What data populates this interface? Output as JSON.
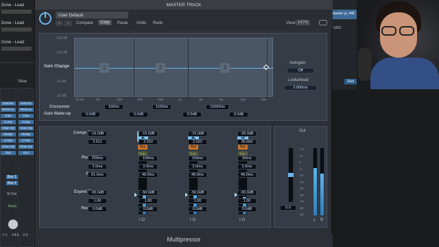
{
  "window": {
    "title": "MASTER TRACK",
    "footer_title": "Multipressor"
  },
  "toolbar": {
    "preset": "User Default",
    "compare": "Compare",
    "copy": "Copy",
    "paste": "Paste",
    "undo": "Undo",
    "redo": "Redo",
    "view_label": "View:",
    "view_value": "147%"
  },
  "graph": {
    "gain_change_label": "Gain Change",
    "y_ticks": [
      "+20 dB",
      "+10 dB",
      "0 dB",
      "-10 dB",
      "-20 dB"
    ],
    "x_ticks": [
      "20 Hz",
      "50",
      "100",
      "200",
      "500",
      "1k",
      "2k",
      "5k",
      "10k",
      "20k"
    ],
    "band_markers": [
      "1",
      "2",
      "3"
    ]
  },
  "crossover": {
    "label": "Crossover",
    "values": [
      "160Hz",
      "1100Hz",
      "15000Hz"
    ],
    "gain_makeup_label": "Gain Make-up",
    "gain_makeup_values": [
      "0.0dB",
      "0.0dB",
      "0.0dB",
      "0.0dB"
    ]
  },
  "autogain": {
    "label": "Autogain",
    "value": "Off",
    "lookahead_label": "Lookahead",
    "lookahead_value": "2.000ms"
  },
  "row_labels": {
    "compr_thresh": "Compr Thresh",
    "ratio": "Ratio",
    "peak_rms": "Peak/RMS",
    "attack": "Attack",
    "release": "Release",
    "expnd_thresh": "Expnd Thresh",
    "ratio2": "Ratio",
    "reduction": "Reduction"
  },
  "bands": [
    {
      "num": "1",
      "compr_thresh": "-16.0dB",
      "ratio": "2.511",
      "peak_rms": "200ms",
      "attack": "2.0ms",
      "release": "61.0ms",
      "expnd_thresh": "-50.0dB",
      "ratio2": "1.00",
      "reduction": "0.0dB",
      "byp": "Byp",
      "solo": "Solo",
      "io": "I  O",
      "level": 0.34
    },
    {
      "num": "2",
      "compr_thresh": "-15.0dB",
      "ratio": "2.022",
      "peak_rms": "100ms",
      "attack": "2.0ms",
      "release": "49.0ms",
      "expnd_thresh": "-50.0dB",
      "ratio2": "1.00",
      "reduction": "0.0dB",
      "byp": "Byp",
      "solo": "Solo",
      "io": "I  O",
      "level": 0.36
    },
    {
      "num": "3",
      "compr_thresh": "-15.0dB",
      "ratio": "2.022",
      "peak_rms": "100ms",
      "attack": "2.0ms",
      "release": "49.0ms",
      "expnd_thresh": "-50.0dB",
      "ratio2": "1.00",
      "reduction": "0.0dB",
      "byp": "Byp",
      "solo": "Solo",
      "io": "I  O",
      "level": 0.32
    },
    {
      "num": "4",
      "compr_thresh": "-39.0dB",
      "ratio": "30.000",
      "peak_rms": "50ms",
      "attack": "2.0ms",
      "release": "49.0ms",
      "expnd_thresh": "-50.0dB",
      "ratio2": "1.00",
      "reduction": "0.0dB",
      "byp": "Byp",
      "solo": "Solo",
      "io": "I  O",
      "level": 0.18
    }
  ],
  "output": {
    "label": "Out",
    "value": "0.0",
    "l": "L",
    "r": "R",
    "scale": [
      "+10",
      "+5",
      "0",
      "-5",
      "-10",
      "-15",
      "-20",
      "-30",
      "-40",
      "-50",
      "-60"
    ],
    "level_l": 0.7,
    "level_r": 0.62
  },
  "daw_left": {
    "tracks": [
      "Done - Lead",
      "Done - Lead",
      "Done - Lead"
    ],
    "strip_buttons": [
      "DeEss2",
      "PitchCor",
      "Gate",
      "Comp",
      "Chan EQ",
      "Multipr",
      "Comp",
      "Chan EQ",
      "Dist"
    ],
    "strip_buttons2": [
      "DeEss2",
      "PitchCor",
      "Gate",
      "Comp",
      "Chan EQ",
      "Multipr",
      "Comp",
      "Chan EQ",
      "Dist"
    ],
    "view_label": "View",
    "bus1": "Bus 1",
    "bus2": "Bus 2",
    "st_out": "St Out",
    "read": "Read",
    "meter_vals": [
      "-7.1",
      "-14.6",
      "-2.0"
    ]
  },
  "daw_right": {
    "track": "master yt_44K",
    "aux": "Aux",
    "num": "1003"
  }
}
